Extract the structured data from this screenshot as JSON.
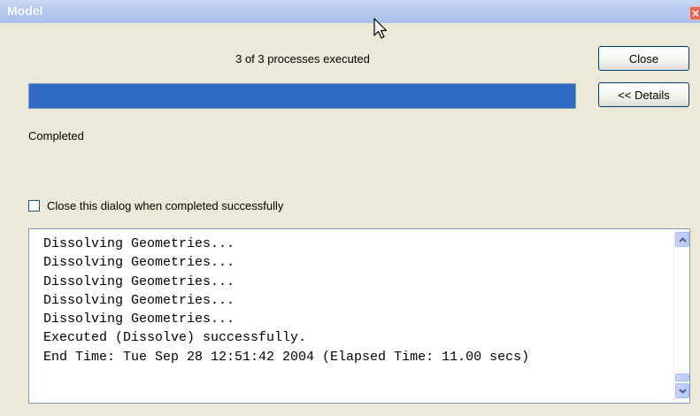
{
  "window": {
    "title": "Model",
    "close_glyph": "×"
  },
  "progress": {
    "status_text": "3 of 3 processes executed",
    "fraction": 1.0,
    "fill_color": "#316ac5"
  },
  "buttons": {
    "close_label": "Close",
    "details_label": "<< Details"
  },
  "result_text": "Completed",
  "checkbox": {
    "label": "Close this dialog when completed successfully",
    "checked": false
  },
  "log": {
    "lines": [
      "Dissolving Geometries...",
      "Dissolving Geometries...",
      "Dissolving Geometries...",
      "Dissolving Geometries...",
      "Dissolving Geometries...",
      "Executed (Dissolve) successfully.",
      "End Time: Tue Sep 28 12:51:42 2004 (Elapsed Time: 11.00 secs)"
    ]
  },
  "colors": {
    "titlebar": "#b4c9ee",
    "dialog_bg": "#ece9d8",
    "close_button": "#e06a57"
  },
  "icons": {
    "cursor": "mouse-pointer-icon",
    "scroll_up": "chevron-up-icon",
    "scroll_down": "chevron-down-icon"
  }
}
